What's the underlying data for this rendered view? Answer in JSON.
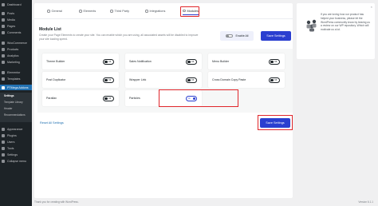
{
  "sidebar": {
    "items": [
      {
        "label": "Dashboard",
        "icon": "dashboard-icon"
      },
      {
        "label": "Posts",
        "icon": "posts-icon"
      },
      {
        "label": "Media",
        "icon": "media-icon"
      },
      {
        "label": "Pages",
        "icon": "pages-icon"
      },
      {
        "label": "Comments",
        "icon": "comments-icon"
      },
      {
        "label": "WooCommerce",
        "icon": "woocommerce-icon"
      },
      {
        "label": "Products",
        "icon": "products-icon"
      },
      {
        "label": "Analytics",
        "icon": "analytics-icon"
      },
      {
        "label": "Marketing",
        "icon": "marketing-icon"
      },
      {
        "label": "Elementor",
        "icon": "elementor-icon"
      },
      {
        "label": "Templates",
        "icon": "templates-icon"
      },
      {
        "label": "PTMega Addons",
        "icon": "addons-icon"
      },
      {
        "label": "Appearance",
        "icon": "appearance-icon"
      },
      {
        "label": "Plugins",
        "icon": "plugins-icon"
      },
      {
        "label": "Users",
        "icon": "users-icon"
      },
      {
        "label": "Tools",
        "icon": "tools-icon"
      },
      {
        "label": "Settings",
        "icon": "settings-icon"
      },
      {
        "label": "Collapse menu",
        "icon": "collapse-icon"
      }
    ],
    "submenu": [
      "Settings",
      "Template Library",
      "Header",
      "Recommendations"
    ]
  },
  "tabs": [
    {
      "label": "General",
      "icon": "gear-icon"
    },
    {
      "label": "Elements",
      "icon": "elements-icon"
    },
    {
      "label": "Third Party",
      "icon": "third-party-icon"
    },
    {
      "label": "Integrations",
      "icon": "integrations-icon"
    },
    {
      "label": "Modules",
      "icon": "modules-icon"
    }
  ],
  "main": {
    "title": "Module List",
    "description": "Create your Page Elements to create your site. You can enable which you are using, all associated assets will be disabled to improve your site loading speed.",
    "enable_all_label": "Enable All",
    "save_label": "Save Settings",
    "reset_label": "Reset All Settings",
    "modules": [
      {
        "name": "Theme Builder",
        "state": "Off"
      },
      {
        "name": "Sales Notification",
        "state": "Off"
      },
      {
        "name": "Menu Builder",
        "state": "Off"
      },
      {
        "name": "Post Duplicator",
        "state": "Off"
      },
      {
        "name": "Wrapper Link",
        "state": "Off"
      },
      {
        "name": "Cross Domain Copy Paste",
        "state": "Off"
      },
      {
        "name": "Parallax",
        "state": "Off"
      },
      {
        "name": "Particles",
        "state": "On"
      }
    ]
  },
  "promo": {
    "close": "×",
    "text": "If you are loving how our product has helped your business, please let the WordPress community know by leaving us a review on our WP repository. Which will motivate us a lot."
  },
  "footer": {
    "left": "Thank you for creating with WordPress.",
    "right": "Version 6.1.1"
  },
  "colors": {
    "accent": "#2b3fd0",
    "highlight": "#e0262b",
    "sidebar_bg": "#1d2327",
    "active_menu": "#2271b1"
  }
}
